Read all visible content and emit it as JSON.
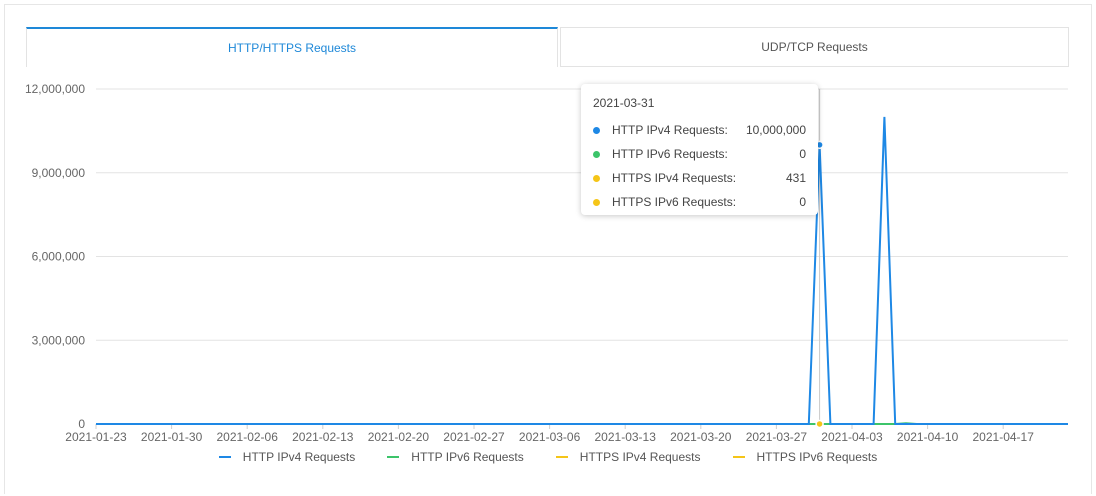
{
  "tabs": [
    {
      "label": "HTTP/HTTPS Requests",
      "active": true
    },
    {
      "label": "UDP/TCP Requests",
      "active": false
    }
  ],
  "tooltip": {
    "date": "2021-03-31",
    "rows": [
      {
        "name": "HTTP IPv4 Requests:",
        "value": "10,000,000",
        "color": "#1e88e5"
      },
      {
        "name": "HTTP IPv6 Requests:",
        "value": "0",
        "color": "#3cc46a"
      },
      {
        "name": "HTTPS IPv4 Requests:",
        "value": "431",
        "color": "#f5c518"
      },
      {
        "name": "HTTPS IPv6 Requests:",
        "value": "0",
        "color": "#f5c518"
      }
    ]
  },
  "chart_data": {
    "type": "line",
    "x_start": "2021-01-23",
    "x_end": "2021-04-23",
    "ylim": [
      0,
      12000000
    ],
    "yticks": [
      0,
      3000000,
      6000000,
      9000000,
      12000000
    ],
    "ytick_labels": [
      "0",
      "3,000,000",
      "6,000,000",
      "9,000,000",
      "12,000,000"
    ],
    "xtick_labels": [
      "2021-01-23",
      "2021-01-30",
      "2021-02-06",
      "2021-02-13",
      "2021-02-20",
      "2021-02-27",
      "2021-03-06",
      "2021-03-13",
      "2021-03-20",
      "2021-03-27",
      "2021-04-03",
      "2021-04-10",
      "2021-04-17"
    ],
    "grid": true,
    "legend_position": "bottom",
    "highlight_date": "2021-03-31",
    "series": [
      {
        "name": "HTTP IPv4 Requests",
        "color": "#1e88e5",
        "points": [
          [
            "2021-01-23",
            0
          ],
          [
            "2021-03-30",
            0
          ],
          [
            "2021-03-31",
            10000000
          ],
          [
            "2021-04-01",
            0
          ],
          [
            "2021-04-05",
            0
          ],
          [
            "2021-04-06",
            11000000
          ],
          [
            "2021-04-07",
            0
          ],
          [
            "2021-04-23",
            0
          ]
        ]
      },
      {
        "name": "HTTP IPv6 Requests",
        "color": "#3cc46a",
        "points": [
          [
            "2021-01-23",
            0
          ],
          [
            "2021-04-07",
            0
          ],
          [
            "2021-04-08",
            30000
          ],
          [
            "2021-04-09",
            0
          ],
          [
            "2021-04-23",
            0
          ]
        ]
      },
      {
        "name": "HTTPS IPv4 Requests",
        "color": "#f5c518",
        "points": [
          [
            "2021-01-23",
            0
          ],
          [
            "2021-03-31",
            431
          ],
          [
            "2021-04-23",
            0
          ]
        ]
      },
      {
        "name": "HTTPS IPv6 Requests",
        "color": "#f5c518",
        "points": [
          [
            "2021-01-23",
            0
          ],
          [
            "2021-04-23",
            0
          ]
        ]
      }
    ]
  }
}
